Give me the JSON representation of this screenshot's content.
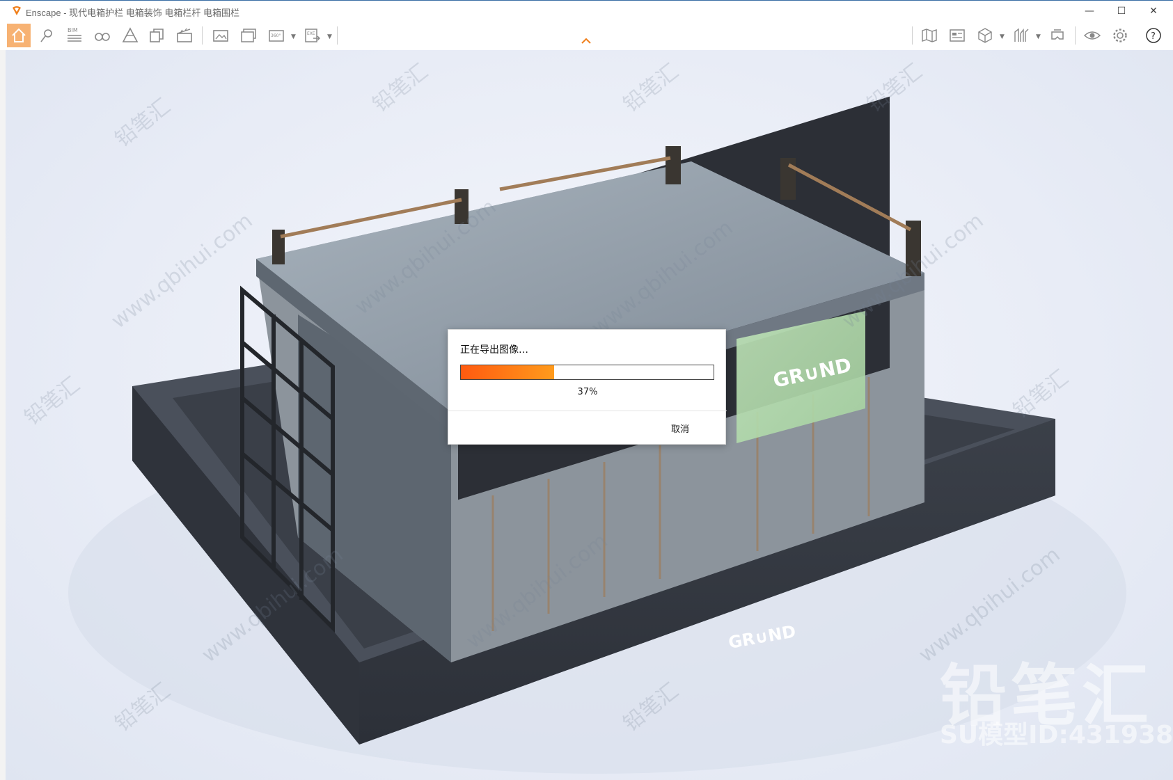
{
  "window": {
    "title": "Enscape - 现代电箱护栏 电箱装饰 电箱栏杆 电箱围栏",
    "minimize_glyph": "—",
    "maximize_glyph": "☐",
    "close_glyph": "✕"
  },
  "toolbar": {
    "bim_label": "BIM",
    "pano_label": "360°",
    "exe_label": "EXE",
    "icons": [
      "home-icon",
      "location-icon",
      "bim-icon",
      "binoculars-icon",
      "asset-library-icon",
      "materials-icon",
      "video-clapper-icon",
      "screenshot-icon",
      "batch-render-icon",
      "panorama-icon",
      "exe-export-icon",
      "map-icon",
      "views-icon",
      "cube-icon",
      "section-icon",
      "vr-headset-icon",
      "visibility-icon",
      "settings-icon",
      "help-icon"
    ],
    "accent_color": "#f7b273"
  },
  "scene": {
    "sign_top": "GR∪ND",
    "sign_front": "GR∪ND",
    "watermark_cn": "铅笔汇",
    "watermark_url": "www.qbihui.com",
    "brand_big": "铅笔汇",
    "brand_id": "SU模型ID:431938"
  },
  "dialog": {
    "title": "正在导出图像…",
    "progress": 0.37,
    "percent_text": "37%",
    "cancel_label": "取消",
    "bar_color_start": "#ff5a10",
    "bar_color_end": "#ff9b1c"
  }
}
